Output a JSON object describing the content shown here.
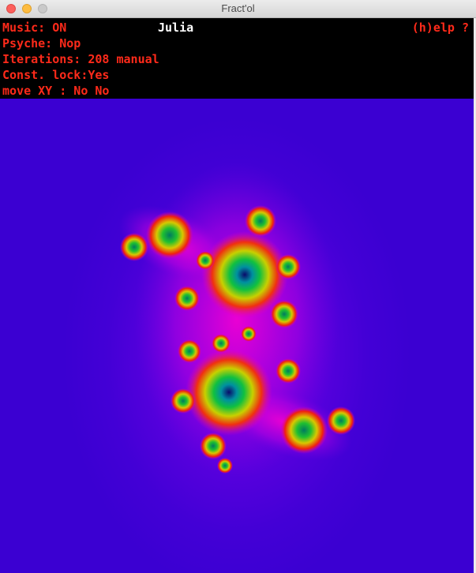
{
  "window": {
    "title": "Fract'ol"
  },
  "hud": {
    "music_label": "Music:",
    "music_value": "ON",
    "fractal_name": "Julia",
    "help": "(h)elp ?",
    "psyche_label": "Psyche:",
    "psyche_value": "Nop",
    "iterations": "Iterations: 208 manual",
    "const_lock": "Const. lock:Yes",
    "move_xy": "move XY : No No"
  },
  "colors": {
    "background": "#3b00d2",
    "hud_text": "#ff2a1a",
    "hud_title": "#ffffff"
  }
}
